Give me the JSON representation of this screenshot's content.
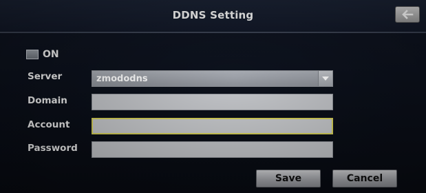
{
  "header": {
    "title": "DDNS Setting",
    "back_icon": "arrow-left-icon"
  },
  "ddns_toggle": {
    "label": "ON",
    "checked": false
  },
  "form": {
    "server": {
      "label": "Server",
      "selected_value": "zmododns",
      "icon": "chevron-down-icon"
    },
    "domain": {
      "label": "Domain",
      "value": ""
    },
    "account": {
      "label": "Account",
      "value": ""
    },
    "password": {
      "label": "Password",
      "value": ""
    }
  },
  "actions": {
    "save_label": "Save",
    "cancel_label": "Cancel"
  },
  "colors": {
    "background": "#0c111c",
    "field_focus_border": "#d9d35a",
    "field_fill": "#c4c6ca"
  }
}
